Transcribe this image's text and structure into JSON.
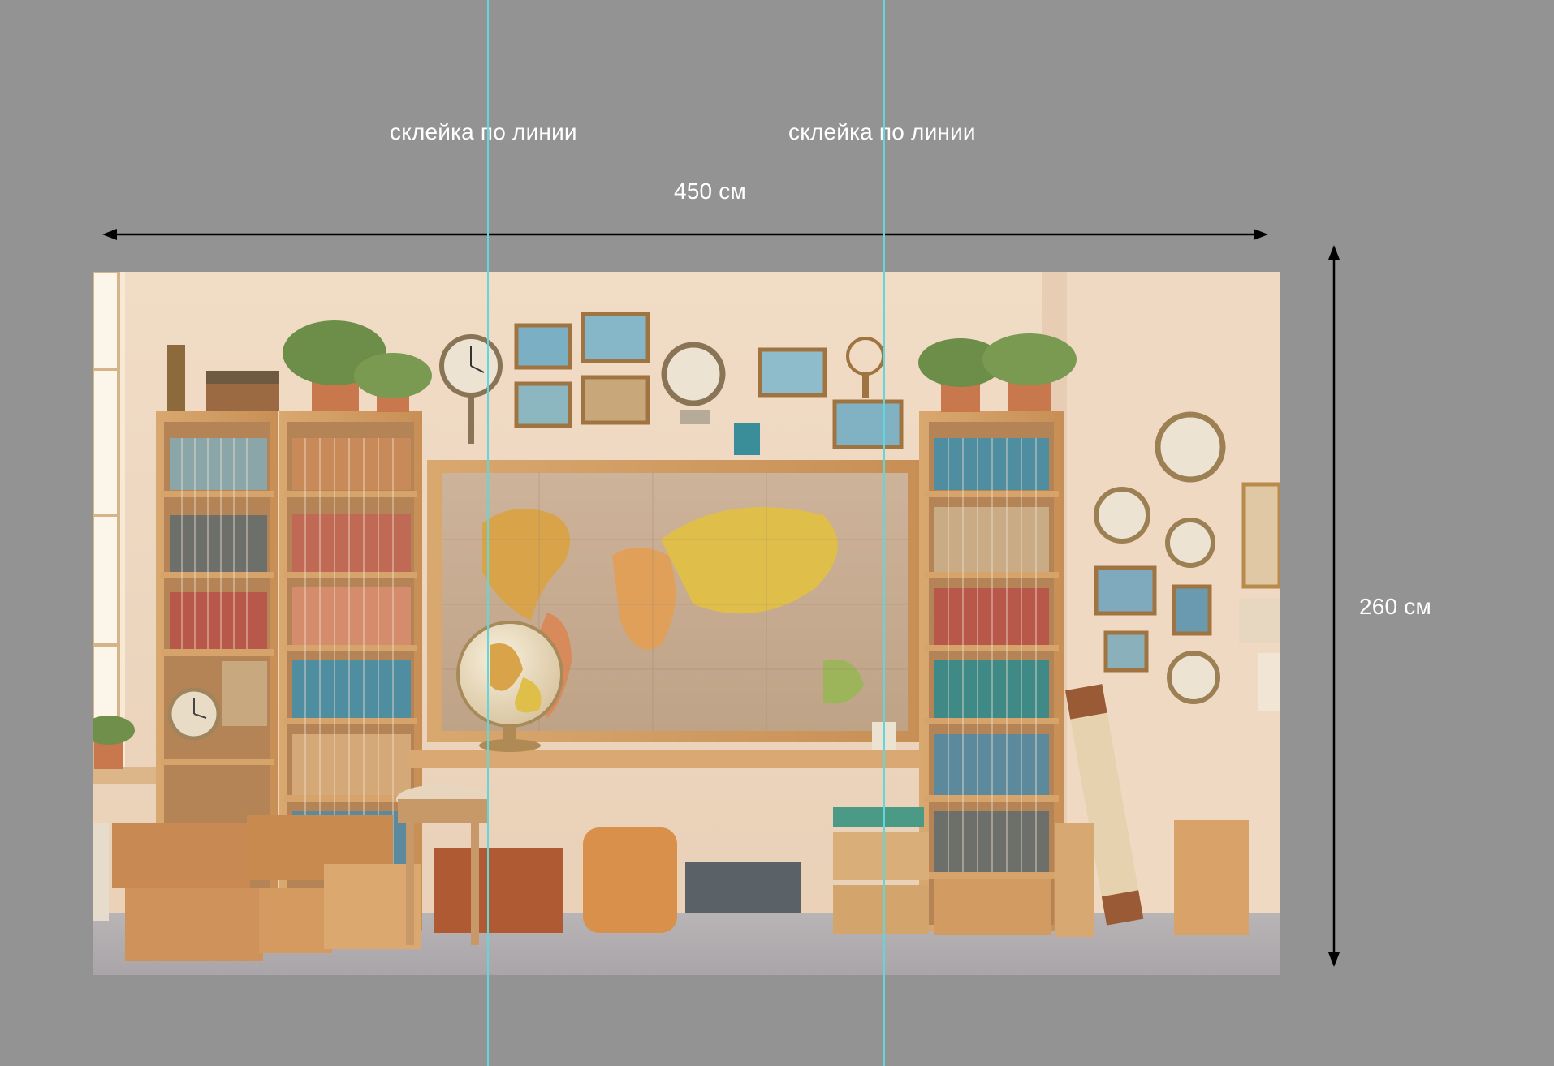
{
  "labels": {
    "seam_left": "склейка по линии",
    "seam_right": "склейка по линии",
    "width": "450 см",
    "height": "260 см"
  },
  "colors": {
    "background": "#939393",
    "seam_line": "#63d6dc",
    "dimension_arrow": "#000000"
  },
  "icons": {
    "width_dimension": "double-horizontal-arrow-icon",
    "height_dimension": "double-vertical-arrow-icon"
  }
}
